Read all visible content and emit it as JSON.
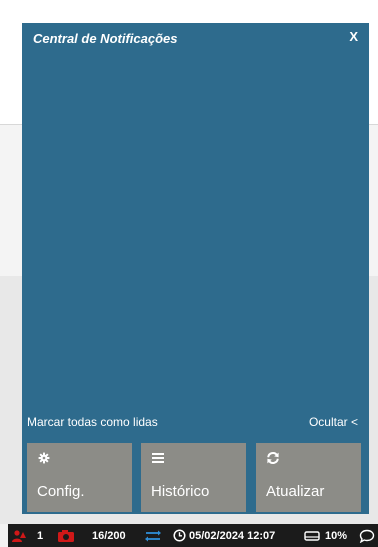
{
  "panel": {
    "title": "Central de Notificações",
    "close_label": "X",
    "mark_all_read": "Marcar todas como lidas",
    "hide": "Ocultar <"
  },
  "buttons": {
    "config": {
      "label": "Config.",
      "icon": "gear-icon"
    },
    "historico": {
      "label": "Histórico",
      "icon": "list-icon"
    },
    "atualizar": {
      "label": "Atualizar",
      "icon": "refresh-icon"
    }
  },
  "statusbar": {
    "users_count": "1",
    "counter": "16/200",
    "datetime": "05/02/2024 12:07",
    "disk_percent": "10%"
  },
  "colors": {
    "panel_bg": "#2e6b8d",
    "button_bg": "#8c8c87",
    "statusbar_bg": "#1b1b1b",
    "alert_red": "#d01818",
    "accent_blue": "#2f8fd8"
  }
}
